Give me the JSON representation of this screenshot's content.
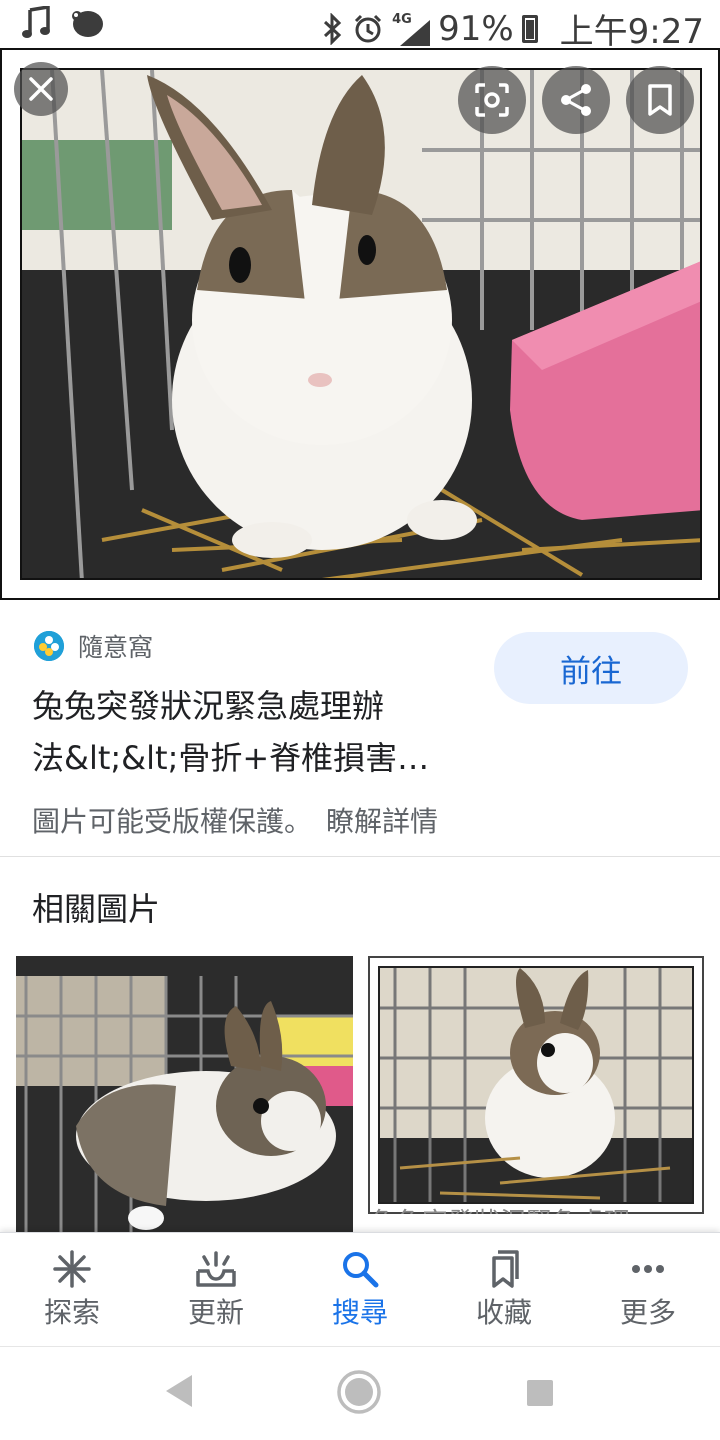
{
  "status_bar": {
    "battery": "91%",
    "time": "上午9:27",
    "network": "4G",
    "icons": [
      "music-note-icon",
      "app-notification-icon",
      "bluetooth-icon",
      "alarm-icon",
      "signal-icon",
      "battery-icon"
    ]
  },
  "image_viewer": {
    "overlay_buttons": [
      "close-icon",
      "lens-icon",
      "share-icon",
      "bookmark-icon"
    ]
  },
  "result": {
    "source_name": "隨意窩",
    "title_line1": "兔兔突發狀況緊急處理辦",
    "title_line2": "法&lt;&lt;骨折+脊椎損害…",
    "visit_label": "前往",
    "copyright_text": "圖片可能受版權保護。",
    "learn_more": "瞭解詳情"
  },
  "related": {
    "title": "相關圖片",
    "second_caption": "兔兔突發狀況緊急處理"
  },
  "bottom_nav": {
    "items": [
      {
        "label": "探索",
        "icon": "asterisk-icon"
      },
      {
        "label": "更新",
        "icon": "updates-icon"
      },
      {
        "label": "搜尋",
        "icon": "search-icon",
        "active": true
      },
      {
        "label": "收藏",
        "icon": "collections-icon"
      },
      {
        "label": "更多",
        "icon": "more-icon"
      }
    ]
  },
  "colors": {
    "accent": "#1a73e8",
    "visit_bg": "#e8f0fe",
    "text_secondary": "#5f6368"
  }
}
